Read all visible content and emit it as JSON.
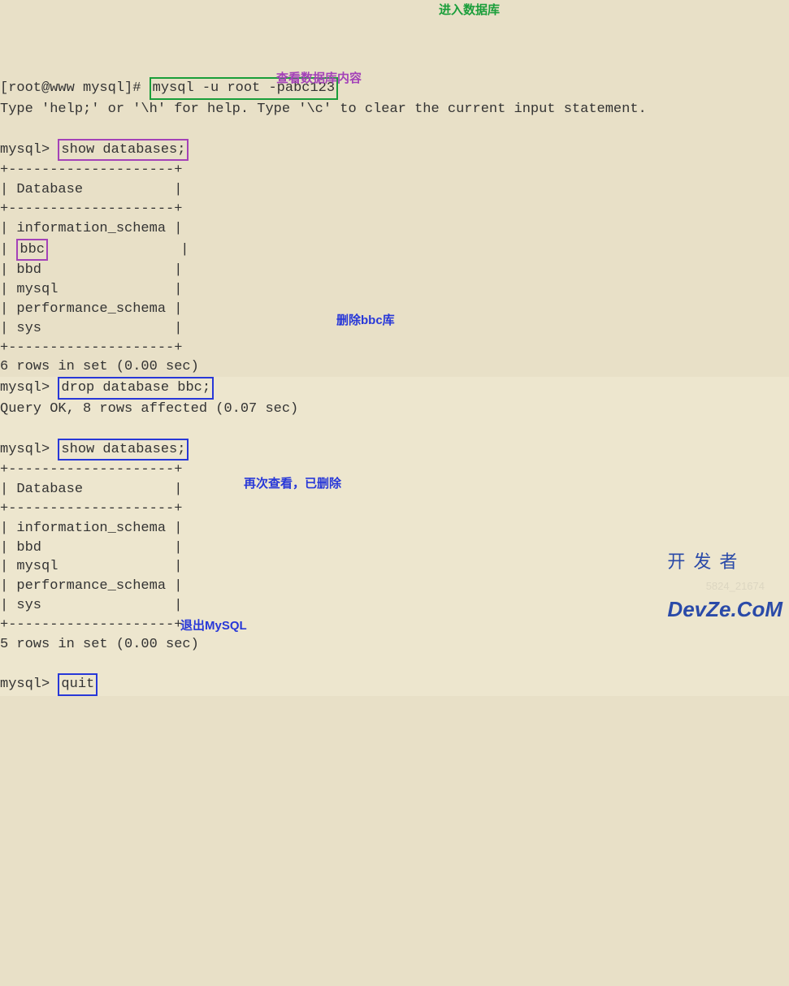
{
  "prompt1_prefix": "[root@www mysql]# ",
  "cmd_login": "mysql -u root -pabc123",
  "ann_login": "进入数据库",
  "help_line": "Type 'help;' or '\\h' for help. Type '\\c' to clear the current input statement.",
  "mysql_prompt": "mysql> ",
  "cmd_show1": "show databases;",
  "ann_show1": "查看数据库内容",
  "tbl_sep": "+--------------------+",
  "tbl_hdr": "| Database           |",
  "db1_rows": {
    "r0": "| information_schema |",
    "r1_pre": "| ",
    "r1_box": "bbc",
    "r1_post": "                |",
    "r2": "| bbd                |",
    "r3": "| mysql              |",
    "r4": "| performance_schema |",
    "r5": "| sys                |"
  },
  "rows_msg1": "6 rows in set (0.00 sec)",
  "cmd_drop": "drop database bbc;",
  "ann_drop": "删除bbc库",
  "drop_result": "Query OK, 8 rows affected (0.07 sec)",
  "cmd_show2": "show databases;",
  "db2_rows": {
    "r0": "| information_schema |",
    "r1": "| bbd                |",
    "r2": "| mysql              |",
    "r3": "| performance_schema |",
    "r4": "| sys                |"
  },
  "ann_again": "再次查看，已删除",
  "rows_msg2": "5 rows in set (0.00 sec)",
  "cmd_quit": "quit",
  "ann_quit": "退出MySQL",
  "watermark_top": "开发者",
  "watermark_bot": "DevZe.CoM",
  "watermark_faint": "5824_21674"
}
